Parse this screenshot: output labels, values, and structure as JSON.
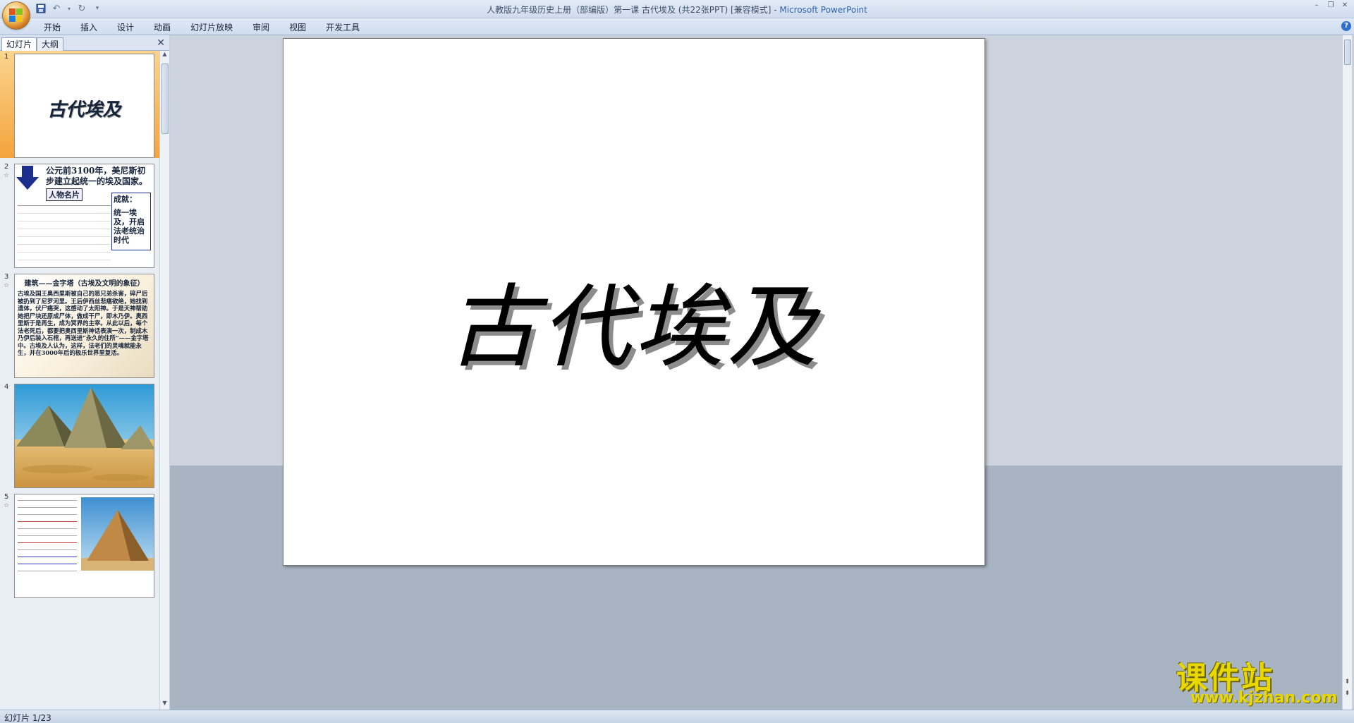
{
  "window": {
    "title": "人教版九年级历史上册（部编版）第一课 古代埃及 (共22张PPT) [兼容模式] - ",
    "app_name": "Microsoft PowerPoint"
  },
  "ribbon": {
    "tabs": [
      "开始",
      "插入",
      "设计",
      "动画",
      "幻灯片放映",
      "审阅",
      "视图",
      "开发工具"
    ]
  },
  "left_panel": {
    "tabs": [
      "幻灯片",
      "大纲"
    ],
    "active_tab": "幻灯片"
  },
  "slides": {
    "current_title": "古代埃及",
    "thumbs": [
      {
        "num": "1",
        "title": "古代埃及"
      },
      {
        "num": "2",
        "headline": "公元前3100年，美尼斯初步建立起统一的埃及国家。",
        "card_label": "人物名片",
        "achievement_label": "成就：",
        "achievement_text": "统一埃及，开启法老统治时代"
      },
      {
        "num": "3",
        "headline": "建筑——金字塔（古埃及文明的象征）",
        "body": "古埃及国王奥西里斯被自己的恶兄弟杀害，碎尸后被扔到了尼罗河里。王后伊西丝悲痛欲绝，她找到遗体，伏尸痛哭，这感动了太阳神。于是天神帮助她把尸块还原成尸体，做成干尸，即木乃伊。奥西里斯于是再生，成为冥界的主宰。从此以后，每个法老死后，都要把奥西里斯神话表演一次，制成木乃伊后装入石棺，再送进“永久的住所”——金字塔中。古埃及人认为，这样，法老们的灵魂就能永生，并在3000年后的极乐世界里复活。"
      },
      {
        "num": "4"
      },
      {
        "num": "5"
      }
    ]
  },
  "status_bar": {
    "slide_indicator": "幻灯片 1/23"
  },
  "watermark": {
    "cn": "课件站",
    "en": "www.kjzhan.com"
  }
}
